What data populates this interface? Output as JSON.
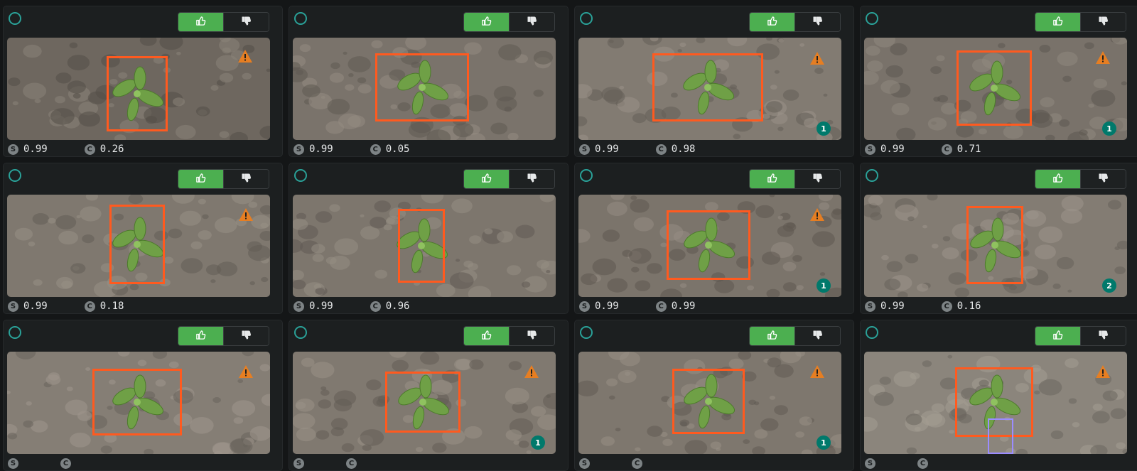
{
  "labels": {
    "s_icon": "S",
    "c_icon": "C"
  },
  "colors": {
    "bbox": "#ff5a1f",
    "vote_up": "#4caf50",
    "badge": "#00796b",
    "select_ring": "#2aa198"
  },
  "icons": {
    "select": "circle-outline-icon",
    "vote_up": "thumbs-up-icon",
    "vote_down": "thumbs-down-icon",
    "warning": "warning-triangle-icon"
  },
  "cards": [
    {
      "s_score": "0.99",
      "c_score": "0.26",
      "warning": true,
      "badge": null
    },
    {
      "s_score": "0.99",
      "c_score": "0.05",
      "warning": false,
      "badge": null
    },
    {
      "s_score": "0.99",
      "c_score": "0.98",
      "warning": true,
      "badge": "1"
    },
    {
      "s_score": "0.99",
      "c_score": "0.71",
      "warning": true,
      "badge": "1"
    },
    {
      "s_score": "0.99",
      "c_score": "0.18",
      "warning": true,
      "badge": null
    },
    {
      "s_score": "0.99",
      "c_score": "0.96",
      "warning": false,
      "badge": null
    },
    {
      "s_score": "0.99",
      "c_score": "0.99",
      "warning": true,
      "badge": "1"
    },
    {
      "s_score": "0.99",
      "c_score": "0.16",
      "warning": false,
      "badge": "2"
    },
    {
      "s_score": "",
      "c_score": "",
      "warning": true,
      "badge": null
    },
    {
      "s_score": "",
      "c_score": "",
      "warning": true,
      "badge": "1"
    },
    {
      "s_score": "",
      "c_score": "",
      "warning": true,
      "badge": "1"
    },
    {
      "s_score": "",
      "c_score": "",
      "warning": true,
      "badge": null
    }
  ]
}
